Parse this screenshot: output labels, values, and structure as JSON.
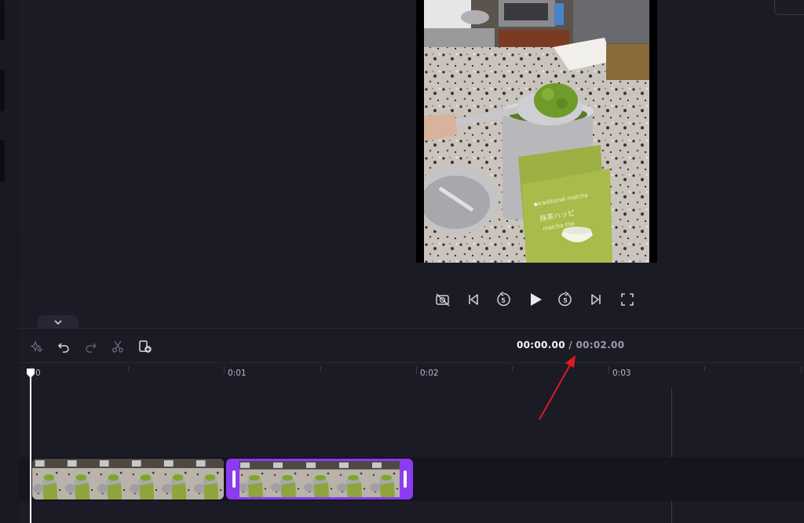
{
  "preview": {
    "video": {
      "scene_text_1": "◆traditional matcha",
      "scene_text_2": "抹茶ハッピ",
      "scene_text_3": "matcha tha"
    }
  },
  "controls": {
    "items": [
      {
        "name": "hide-captions",
        "icon": "camera-off-icon"
      },
      {
        "name": "skip-back",
        "icon": "skip-back-icon"
      },
      {
        "name": "rewind-5",
        "icon": "rewind-5-icon",
        "label": "5"
      },
      {
        "name": "play",
        "icon": "play-icon"
      },
      {
        "name": "forward-5",
        "icon": "forward-5-icon",
        "label": "5"
      },
      {
        "name": "skip-forward",
        "icon": "skip-forward-icon"
      },
      {
        "name": "fullscreen",
        "icon": "fullscreen-icon"
      }
    ]
  },
  "timeline": {
    "toolbar": [
      {
        "name": "magic",
        "icon": "sparkle-icon"
      },
      {
        "name": "undo",
        "icon": "undo-icon"
      },
      {
        "name": "redo",
        "icon": "redo-icon"
      },
      {
        "name": "split",
        "icon": "scissors-icon"
      },
      {
        "name": "add-media",
        "icon": "add-clip-icon"
      }
    ],
    "current_time": "00:00.00",
    "separator": " / ",
    "total_time": "00:02.00",
    "ruler_labels": [
      "0",
      "0:01",
      "0:02",
      "0:03"
    ]
  },
  "colors": {
    "background": "#1b1b26",
    "accent": "#8c3bf0",
    "arrow": "#e0191f"
  }
}
